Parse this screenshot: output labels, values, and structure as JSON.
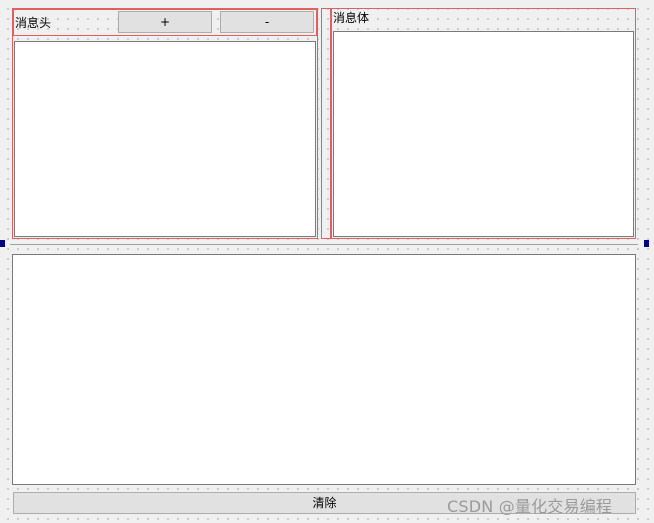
{
  "top_left_panel": {
    "title": "消息头",
    "add_button_label": "+",
    "remove_button_label": "-"
  },
  "top_right_panel": {
    "title": "消息体"
  },
  "bottom": {
    "clear_button_label": "清除"
  },
  "watermark": {
    "text": "CSDN @量化交易编程"
  },
  "colors": {
    "layout_border": "#e06060",
    "background": "#f0f0f0",
    "button_face": "#e1e1e1",
    "handle": "#000080"
  }
}
